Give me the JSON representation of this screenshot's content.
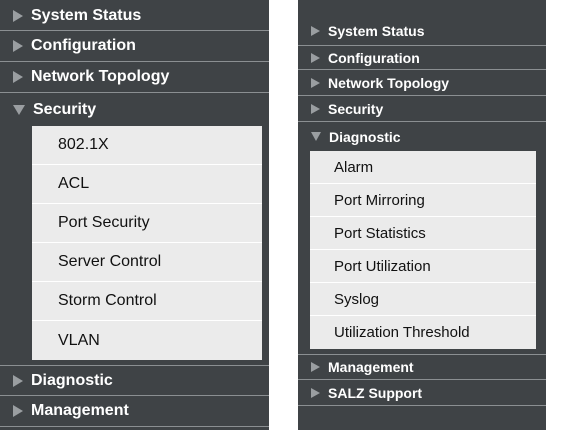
{
  "left_menu": {
    "top_items": [
      {
        "label": "System Status"
      },
      {
        "label": "Configuration"
      },
      {
        "label": "Network Topology"
      }
    ],
    "expanded": {
      "label": "Security",
      "children": [
        {
          "label": "802.1X"
        },
        {
          "label": "ACL"
        },
        {
          "label": "Port Security"
        },
        {
          "label": "Server Control"
        },
        {
          "label": "Storm Control"
        },
        {
          "label": "VLAN"
        }
      ]
    },
    "bottom_items": [
      {
        "label": "Diagnostic"
      },
      {
        "label": "Management"
      }
    ]
  },
  "right_menu": {
    "top_items": [
      {
        "label": "System Status"
      },
      {
        "label": "Configuration"
      },
      {
        "label": "Network Topology"
      },
      {
        "label": "Security"
      }
    ],
    "expanded": {
      "label": "Diagnostic",
      "children": [
        {
          "label": "Alarm"
        },
        {
          "label": "Port Mirroring"
        },
        {
          "label": "Port Statistics"
        },
        {
          "label": "Port Utilization"
        },
        {
          "label": "Syslog"
        },
        {
          "label": "Utilization Threshold"
        }
      ]
    },
    "bottom_items": [
      {
        "label": "Management"
      },
      {
        "label": "SALZ Support"
      }
    ]
  },
  "colors": {
    "panel_bg": "#3f4346",
    "submenu_bg": "#ebebeb",
    "arrow": "#9a9ea1",
    "divider": "#8b8f92"
  },
  "icons": {
    "collapsed": "triangle-right-icon",
    "expanded": "triangle-down-icon"
  }
}
